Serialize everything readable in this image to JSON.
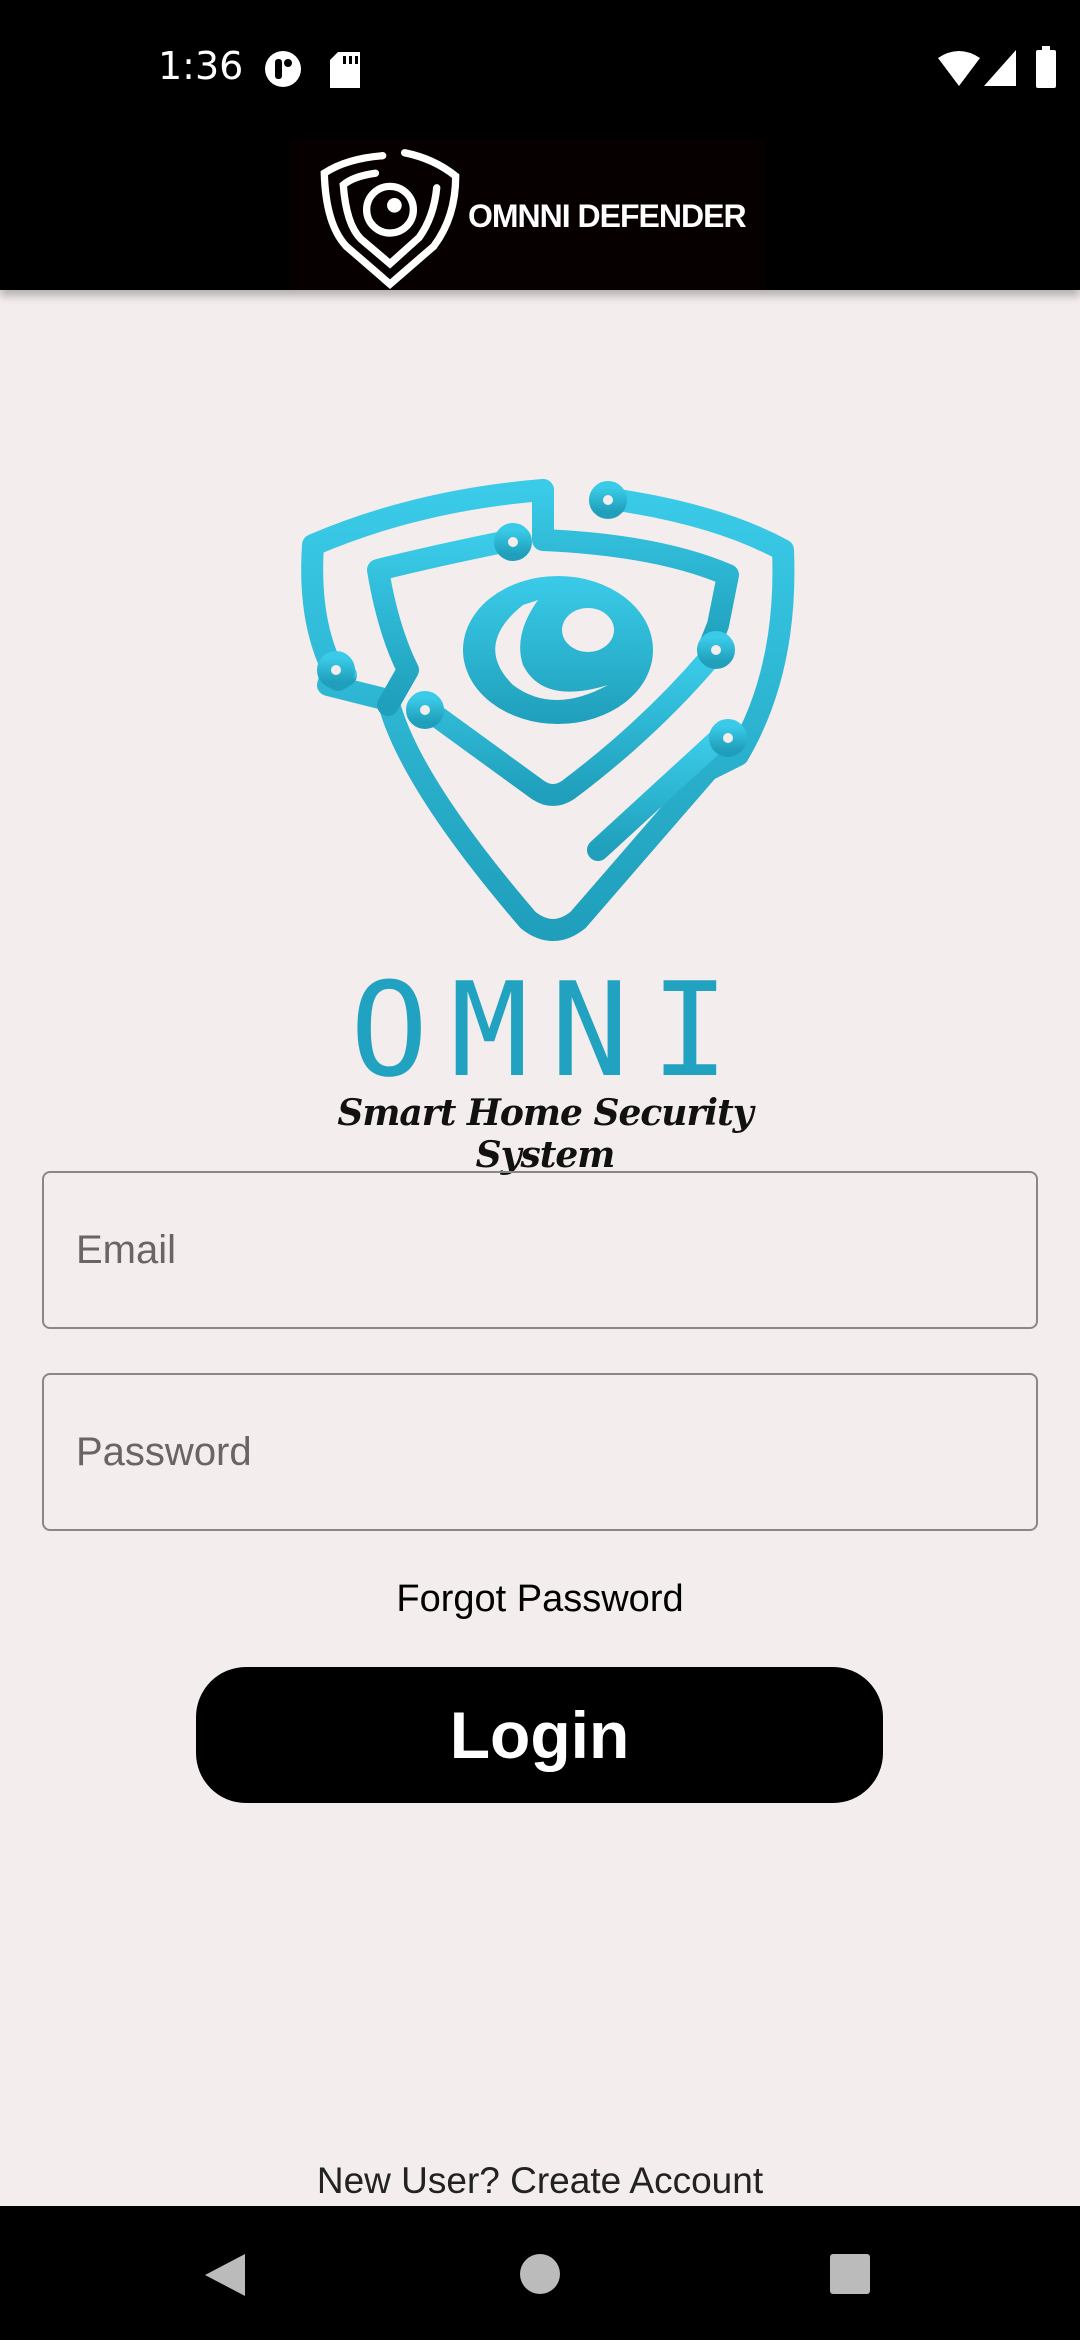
{
  "status_bar": {
    "time": "1:36"
  },
  "header": {
    "title": "OMNNI DEFENDER"
  },
  "logo": {
    "wordmark": "OMNI",
    "tagline": "Smart Home Security System"
  },
  "form": {
    "email_placeholder": "Email",
    "email_value": "",
    "password_placeholder": "Password",
    "password_value": "",
    "forgot_label": "Forgot Password",
    "login_label": "Login",
    "create_account_label": "New User? Create Account"
  },
  "colors": {
    "brand": "#2eb8d8",
    "background": "#f4eded"
  }
}
